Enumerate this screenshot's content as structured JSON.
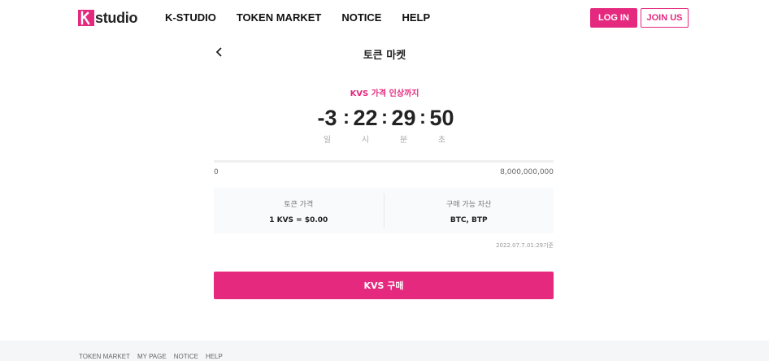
{
  "header": {
    "logo_k": "k",
    "logo_text": "studio",
    "nav": [
      "K-STUDIO",
      "TOKEN MARKET",
      "NOTICE",
      "HELP"
    ],
    "login_label": "LOG IN",
    "join_label": "JOIN US"
  },
  "page": {
    "title": "토큰 마켓"
  },
  "countdown": {
    "subtitle": "KVS 가격 인상까지",
    "days": "-3",
    "hours": "22",
    "minutes": "29",
    "seconds": "50",
    "separator": ":",
    "days_label": "일",
    "hours_label": "시",
    "minutes_label": "분",
    "seconds_label": "초"
  },
  "progress": {
    "min_label": "0",
    "max_label": "8,000,000,000",
    "fraction": 0
  },
  "info": {
    "price_label": "토큰 가격",
    "price_value": "1 KVS = $0.00",
    "assets_label": "구매 가능 자산",
    "assets_value": "BTC, BTP"
  },
  "timestamp": "2022.07.7.01:29기준",
  "buy_label": "KVS 구매",
  "footer": {
    "links": [
      "TOKEN MARKET",
      "MY PAGE",
      "NOTICE",
      "HELP"
    ]
  },
  "colors": {
    "accent": "#e5297e",
    "footer_bg": "#f5f6f8",
    "info_bg": "#f8fafc"
  },
  "icons": {
    "back": "chevron-left-icon"
  }
}
